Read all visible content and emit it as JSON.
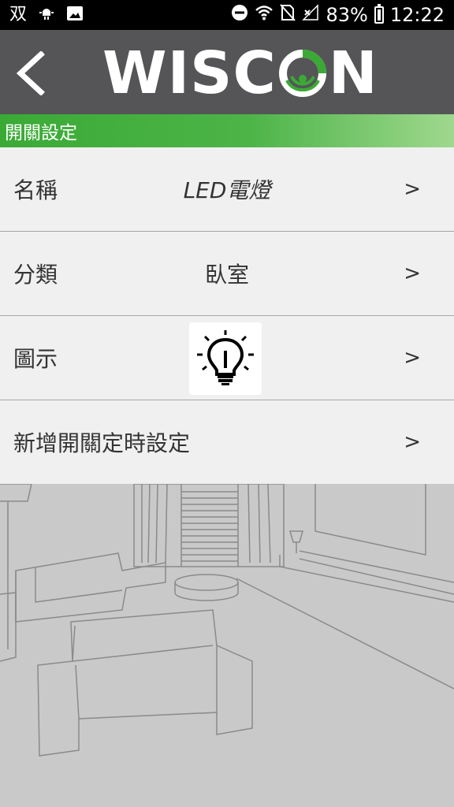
{
  "status_bar": {
    "time": "12:22",
    "battery_percent": "83%",
    "carrier_glyph": "双",
    "left_icons": [
      "carrier-icon",
      "usb-debug-icon",
      "image-icon",
      "moon-icon"
    ],
    "right_icons": [
      "do-not-disturb-icon",
      "wifi-icon",
      "no-sim-icon",
      "signal-icon",
      "battery-icon"
    ]
  },
  "header": {
    "logo_text_left": "WISC",
    "logo_text_right": "N",
    "brand_color": "#3aaa35"
  },
  "section": {
    "title": "開關設定"
  },
  "settings": {
    "name": {
      "label": "名稱",
      "value": "LED電燈",
      "chevron": ">"
    },
    "category": {
      "label": "分類",
      "value": "臥室",
      "chevron": ">"
    },
    "icon": {
      "label": "圖示",
      "chevron": ">",
      "icon_name": "lightbulb-icon"
    },
    "timer": {
      "label": "新增開關定時設定",
      "chevron": ">"
    }
  }
}
